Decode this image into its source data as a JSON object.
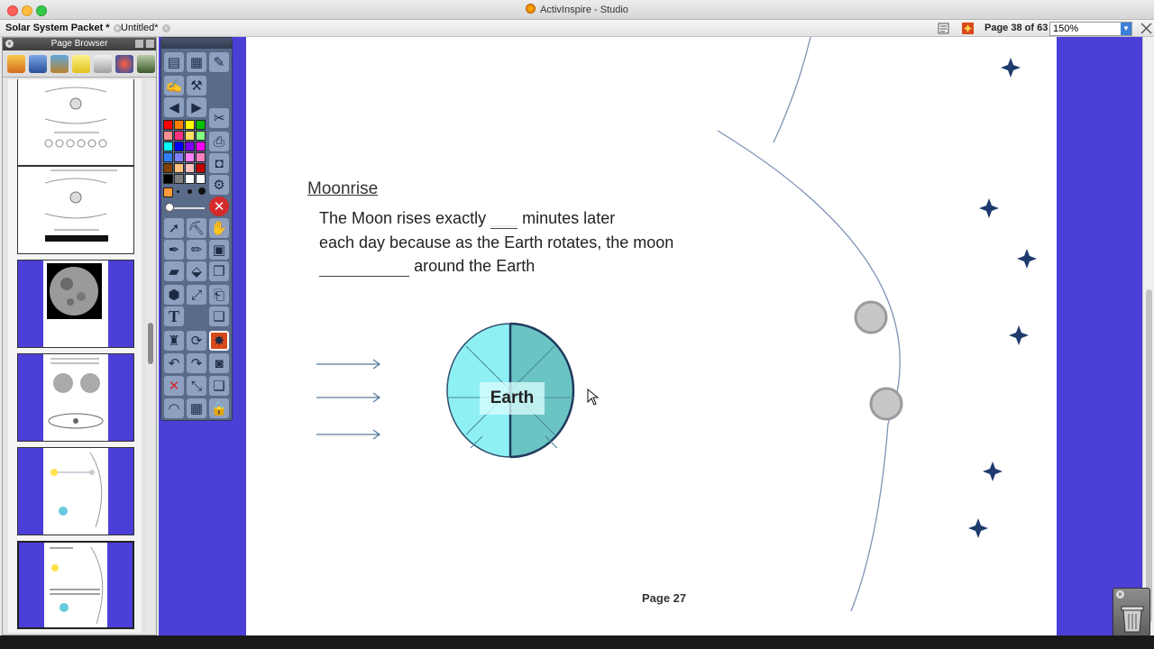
{
  "window": {
    "title": "ActivInspire - Studio"
  },
  "tabs": [
    {
      "label": "Solar System Packet *"
    },
    {
      "label": "Untitled*"
    }
  ],
  "toolbar": {
    "page_indicator": "Page 38 of 63",
    "zoom": "150%"
  },
  "page_browser": {
    "title": "Page Browser",
    "tool_icons": [
      "page-browser-icon",
      "resource-browser-icon",
      "object-browser-icon",
      "notes-browser-icon",
      "property-browser-icon",
      "action-browser-icon",
      "voting-browser-icon"
    ]
  },
  "toolbox": {
    "colors": [
      "#ff0000",
      "#ff8000",
      "#ffff00",
      "#00c000",
      "#ff9090",
      "#ff3080",
      "#ffe060",
      "#80ff80",
      "#00ffff",
      "#0000ff",
      "#8000ff",
      "#ff00ff",
      "#3080ff",
      "#8080ff",
      "#ff80ff",
      "#ff80c0",
      "#804000",
      "#ffc080",
      "#ffc0c0",
      "#c00000",
      "#000000",
      "#808080",
      "#ffffff",
      "#ffffff"
    ]
  },
  "canvas": {
    "heading": "Moonrise",
    "sentence": {
      "line1_before": "The Moon rises exactly",
      "line1_blank": "___",
      "line1_after": "minutes later",
      "line2": "each day because as the Earth rotates, the moon",
      "line3_blank": "__________",
      "line3_after": "around the Earth"
    },
    "earth_label": "Earth",
    "page_number": "Page 27"
  },
  "colors": {
    "band": "#4b3fd8",
    "earth_light": "#8ff0f4",
    "earth_dark": "#6bc4c4",
    "star": "#1e3a6e",
    "arrow": "#5a7a9a"
  }
}
